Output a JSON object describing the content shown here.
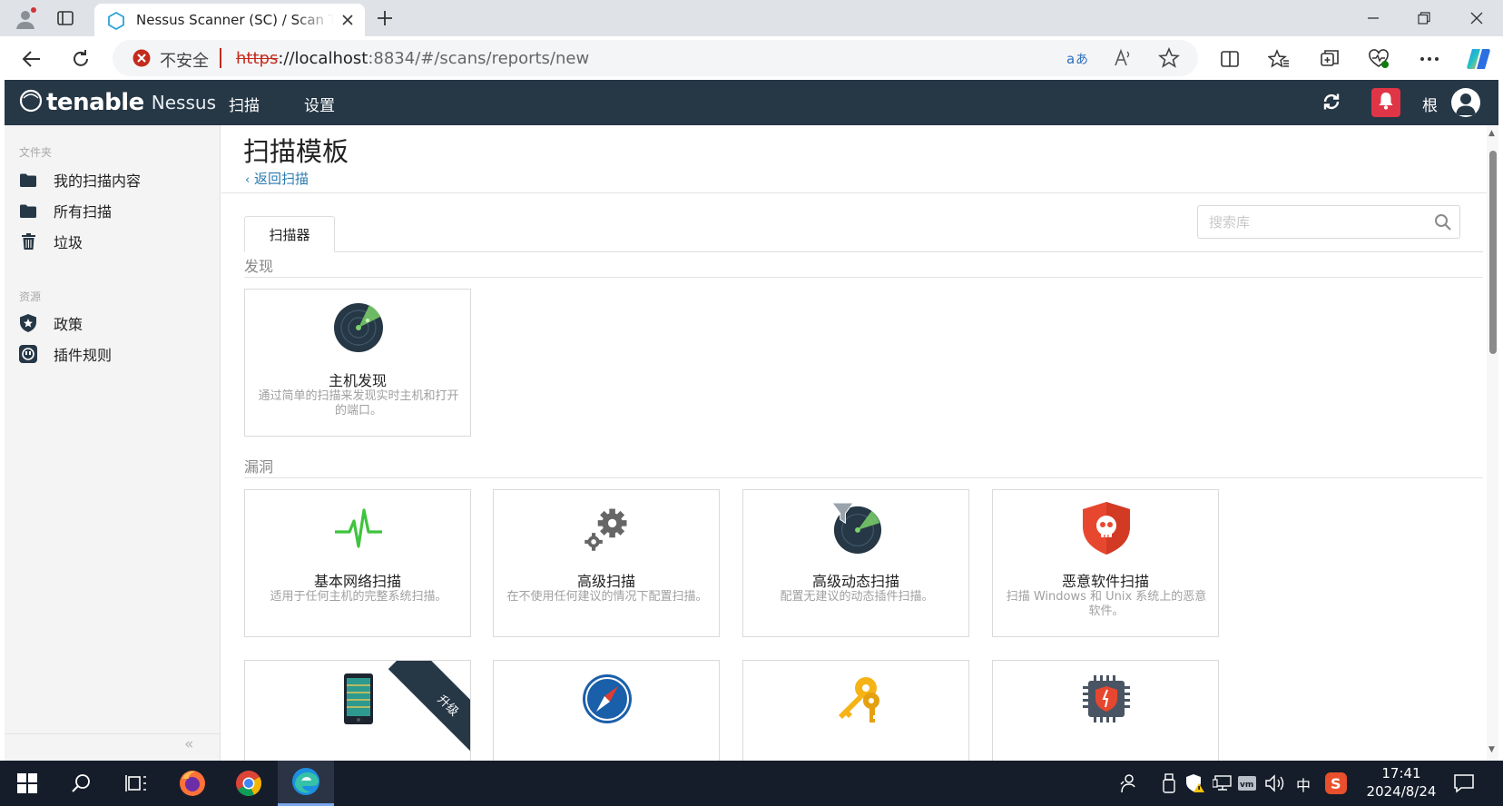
{
  "browser": {
    "tab_title": "Nessus Scanner (SC) / Scan Templates",
    "security_label": "不安全",
    "url_scheme": "https",
    "url_host": "://localhost",
    "url_rest": ":8834/#/scans/reports/new"
  },
  "app": {
    "brand_word": "tenable",
    "brand_product": "Nessus",
    "nav": [
      "扫描",
      "设置"
    ],
    "user_label": "根"
  },
  "sidebar": {
    "folders_header": "文件夹",
    "folders": [
      {
        "label": "我的扫描内容",
        "icon": "folder-icon"
      },
      {
        "label": "所有扫描",
        "icon": "folder-icon"
      },
      {
        "label": "垃圾",
        "icon": "trash-icon"
      }
    ],
    "resources_header": "资源",
    "resources": [
      {
        "label": "政策",
        "icon": "shield-icon"
      },
      {
        "label": "插件规则",
        "icon": "plugin-icon"
      }
    ],
    "collapse_glyph": "«"
  },
  "main": {
    "title": "扫描模板",
    "back_link": "返回扫描",
    "tab_label": "扫描器",
    "search_placeholder": "搜索库",
    "sections": [
      {
        "label": "发现",
        "cards": [
          {
            "title": "主机发现",
            "desc": "通过简单的扫描来发现实时主机和打开的端口。",
            "icon": "radar-icon"
          }
        ]
      },
      {
        "label": "漏洞",
        "cards": [
          {
            "title": "基本网络扫描",
            "desc": "适用于任何主机的完整系统扫描。",
            "icon": "pulse-icon"
          },
          {
            "title": "高级扫描",
            "desc": "在不使用任何建议的情况下配置扫描。",
            "icon": "gears-icon"
          },
          {
            "title": "高级动态扫描",
            "desc": "配置无建议的动态插件扫描。",
            "icon": "funnel-radar-icon"
          },
          {
            "title": "恶意软件扫描",
            "desc": "扫描 Windows 和 Unix 系统上的恶意软件。",
            "icon": "skull-shield-icon"
          }
        ],
        "partial_cards": [
          {
            "icon": "mobile-icon",
            "ribbon": "升级"
          },
          {
            "icon": "compass-icon"
          },
          {
            "icon": "keys-icon"
          },
          {
            "icon": "chip-shield-icon"
          }
        ]
      }
    ]
  },
  "taskbar": {
    "ime": "中",
    "time": "17:41",
    "date": "2024/8/24"
  },
  "colors": {
    "header_bg": "#263746",
    "link": "#2a7ab0",
    "alert": "#e03546",
    "accent_green": "#3ec43e",
    "malware_red": "#e8472f"
  }
}
